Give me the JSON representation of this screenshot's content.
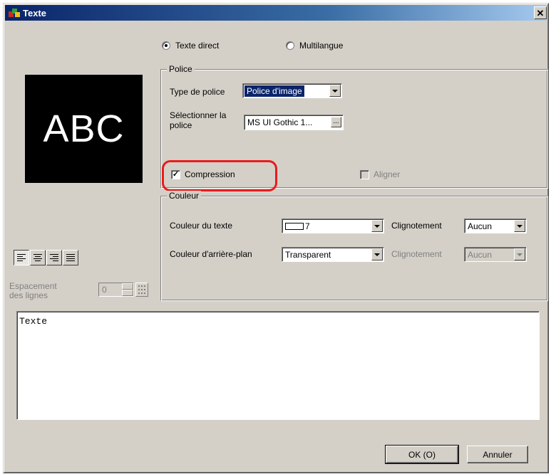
{
  "window": {
    "title": "Texte"
  },
  "mode": {
    "direct_label": "Texte direct",
    "multilang_label": "Multilangue",
    "selected": "direct"
  },
  "preview": {
    "text": "ABC"
  },
  "police": {
    "group_label": "Police",
    "type_label": "Type de police",
    "type_value": "Police d'image",
    "select_label_line1": "Sélectionner la",
    "select_label_line2": "police",
    "font_value": "MS UI Gothic 1...",
    "ellipsis": "...",
    "compression_label": "Compression",
    "compression_checked": true,
    "align_label": "Aligner",
    "align_checked": false
  },
  "couleur": {
    "group_label": "Couleur",
    "text_color_label": "Couleur du texte",
    "text_color_value": "7",
    "blink_label_1": "Clignotement",
    "blink_value_1": "Aucun",
    "bg_color_label": "Couleur d'arrière-plan",
    "bg_color_value": "Transparent",
    "blink_label_2": "Clignotement",
    "blink_value_2": "Aucun"
  },
  "spacing": {
    "label_line1": "Espacement",
    "label_line2": "des lignes",
    "value": "0"
  },
  "text_content": "Texte",
  "buttons": {
    "ok_label": "OK (O)",
    "cancel_label": "Annuler"
  }
}
